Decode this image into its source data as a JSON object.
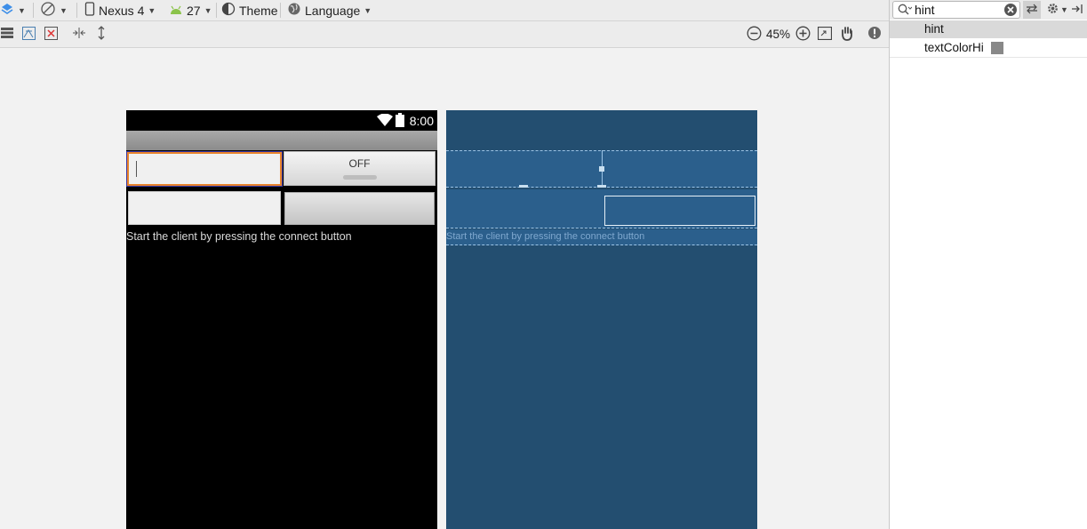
{
  "toolbar": {
    "device": "Nexus 4",
    "api_level": "27",
    "theme": "Theme",
    "language": "Language",
    "zoom": "45%"
  },
  "phone": {
    "clock": "8:00",
    "toggle_label": "OFF",
    "message": "Start the client by pressing the connect button"
  },
  "blueprint": {
    "message": "Start the client by pressing the connect button"
  },
  "panel": {
    "search_value": "hint",
    "attributes": [
      {
        "label": "hint"
      },
      {
        "label": "textColorHi"
      }
    ],
    "swatch_color": "#888888"
  },
  "colors": {
    "blueprint_bg": "#234e70",
    "focus_border": "#e8822a",
    "toolbar_bg": "#ececec"
  }
}
